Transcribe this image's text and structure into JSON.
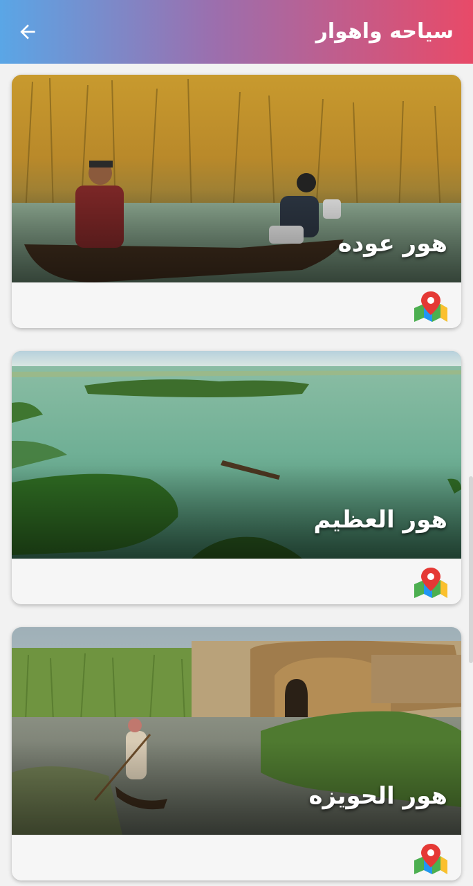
{
  "appbar": {
    "title": "سياحه واهوار",
    "back_icon": "arrow-left-icon"
  },
  "cards": [
    {
      "title": "هور عوده",
      "image": "marsh-reeds-boat-photo",
      "map_icon": "map-pin-icon"
    },
    {
      "title": "هور العظيم",
      "image": "marsh-lake-aerial-photo",
      "map_icon": "map-pin-icon"
    },
    {
      "title": "هور الحويزه",
      "image": "marsh-reed-house-photo",
      "map_icon": "map-pin-icon"
    }
  ],
  "colors": {
    "appbar_gradient_start": "#5aa6e6",
    "appbar_gradient_end": "#e84a68",
    "map_pin": "#e53935"
  }
}
